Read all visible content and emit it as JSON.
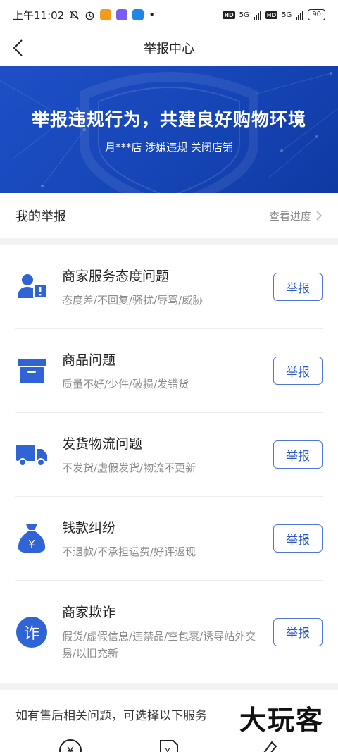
{
  "status_bar": {
    "time": "上午11:02",
    "net1": "5G",
    "net2": "5G",
    "battery": "90"
  },
  "nav": {
    "title": "举报中心"
  },
  "banner": {
    "title": "举报违规行为，共建良好购物环境",
    "subtitle": "月***店 涉嫌违规 关闭店铺"
  },
  "my_report": {
    "title": "我的举报",
    "progress_link": "查看进度"
  },
  "categories": [
    {
      "title": "商家服务态度问题",
      "desc": "态度差/不回复/骚扰/辱骂/威胁",
      "button": "举报",
      "icon": "user-alert-icon"
    },
    {
      "title": "商品问题",
      "desc": "质量不好/少件/破损/发错货",
      "button": "举报",
      "icon": "box-icon"
    },
    {
      "title": "发货物流问题",
      "desc": "不发货/虚假发货/物流不更新",
      "button": "举报",
      "icon": "truck-icon"
    },
    {
      "title": "钱款纠纷",
      "desc": "不退款/不承担运费/好评返现",
      "button": "举报",
      "icon": "money-bag-icon"
    },
    {
      "title": "商家欺诈",
      "desc": "假货/虚假信息/违禁品/空包裹/诱导站外交易/以旧充新",
      "button": "举报",
      "icon": "fraud-icon",
      "icon_text": "诈"
    }
  ],
  "after_sale": {
    "text": "如有售后相关问题，可选择以下服务"
  },
  "watermark": "大玩客",
  "colors": {
    "accent": "#2f63d6",
    "banner": "#1646b8",
    "muted": "#8c8c8c"
  }
}
